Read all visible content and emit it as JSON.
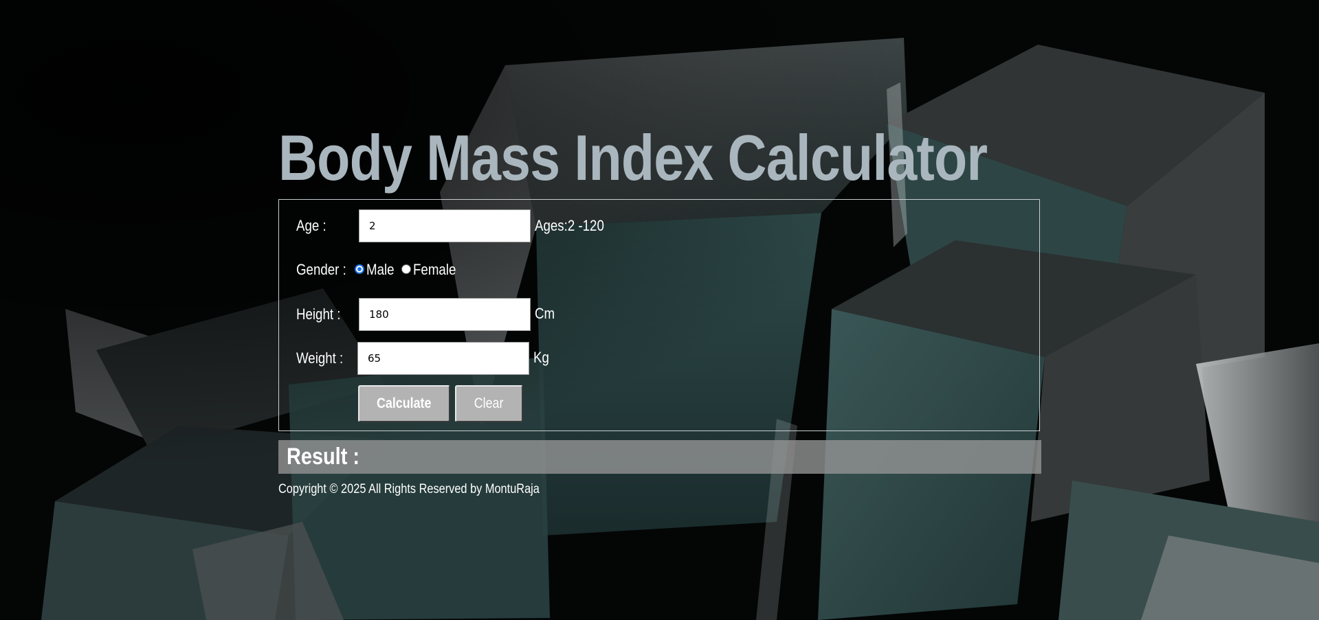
{
  "page": {
    "title": "Body Mass Index Calculator"
  },
  "form": {
    "age": {
      "label": "Age :",
      "value": "2",
      "hint": "Ages:2 -120"
    },
    "gender": {
      "label": "Gender :",
      "options": [
        {
          "label": "Male",
          "checked": true
        },
        {
          "label": "Female",
          "checked": false
        }
      ]
    },
    "height": {
      "label": "Height :",
      "value": "180",
      "unit": "Cm"
    },
    "weight": {
      "label": "Weight :",
      "value": "65",
      "unit": "Kg"
    },
    "buttons": {
      "calculate": "Calculate",
      "clear": "Clear"
    }
  },
  "result": {
    "label": "Result :"
  },
  "footer": {
    "copyright": "Copyright © 2025 All Rights Reserved by MontuRaja"
  },
  "colors": {
    "title": "#a9b6bd",
    "accent_radio": "#1a73e8",
    "button_bg": "#b3b3b3",
    "result_bg": "#969696",
    "background": "#050707"
  }
}
